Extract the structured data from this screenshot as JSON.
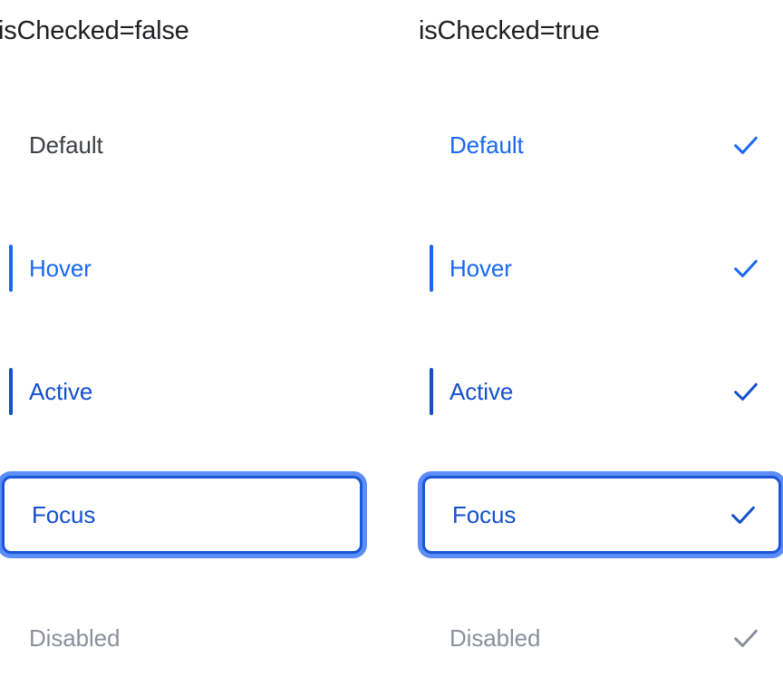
{
  "columns": [
    {
      "header": "isChecked=false",
      "checked": false,
      "rows": [
        {
          "label": "Default",
          "state": "default",
          "text_color": "#3c4043",
          "accent_bar": false,
          "focus_ring": false,
          "check": false
        },
        {
          "label": "Hover",
          "state": "hover",
          "text_color": "#1a68f0",
          "accent_bar": true,
          "focus_ring": false,
          "check": false
        },
        {
          "label": "Active",
          "state": "active",
          "text_color": "#1450cc",
          "accent_bar": true,
          "focus_ring": false,
          "check": false
        },
        {
          "label": "Focus",
          "state": "focus",
          "text_color": "#1450cc",
          "accent_bar": false,
          "focus_ring": true,
          "check": false
        },
        {
          "label": "Disabled",
          "state": "disabled",
          "text_color": "#8b919c",
          "accent_bar": false,
          "focus_ring": false,
          "check": false
        }
      ]
    },
    {
      "header": "isChecked=true",
      "checked": true,
      "rows": [
        {
          "label": "Default",
          "state": "default",
          "text_color": "#1a68f0",
          "accent_bar": false,
          "focus_ring": false,
          "check": true,
          "check_color": "#1a68f0"
        },
        {
          "label": "Hover",
          "state": "hover",
          "text_color": "#1a68f0",
          "accent_bar": true,
          "focus_ring": false,
          "check": true,
          "check_color": "#1a68f0"
        },
        {
          "label": "Active",
          "state": "active",
          "text_color": "#1450cc",
          "accent_bar": true,
          "focus_ring": false,
          "check": true,
          "check_color": "#1450cc"
        },
        {
          "label": "Focus",
          "state": "focus",
          "text_color": "#1450cc",
          "accent_bar": false,
          "focus_ring": true,
          "check": true,
          "check_color": "#1450cc"
        },
        {
          "label": "Disabled",
          "state": "disabled",
          "text_color": "#8b919c",
          "accent_bar": false,
          "focus_ring": false,
          "check": true,
          "check_color": "#8b919c"
        }
      ]
    }
  ],
  "theme": {
    "accent_blue": "#1a68f0",
    "accent_blue_dark": "#1450cc",
    "focus_ring_outer": "#5b8df9",
    "focus_ring_inner": "#1a56d6",
    "text_dark": "#3c4043",
    "text_disabled": "#8b919c",
    "header_text": "#1f2023",
    "background": "#ffffff"
  },
  "icons": {
    "check": "check-icon"
  }
}
